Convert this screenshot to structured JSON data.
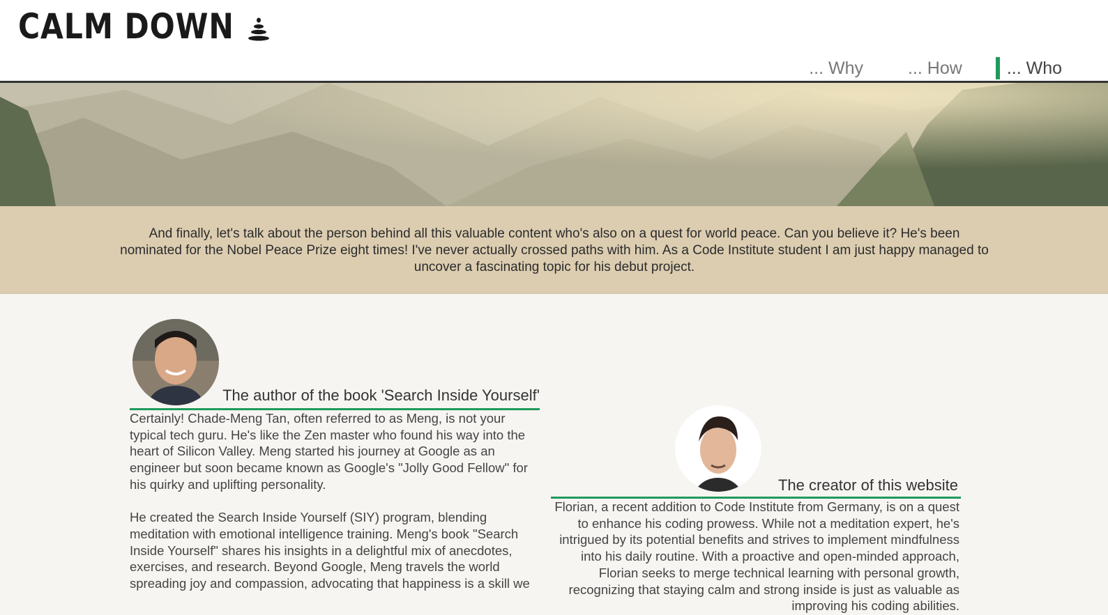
{
  "brand": {
    "logo_text": "CALM DOWN",
    "logo_icon": "stacked-stones-icon"
  },
  "nav": {
    "items": [
      {
        "label": "... Why",
        "active": false
      },
      {
        "label": "... How",
        "active": false
      },
      {
        "label": "... Who",
        "active": true
      }
    ],
    "accent_color": "#1f9a5a"
  },
  "hero": {
    "image": "misty-mountain-valley"
  },
  "intro": {
    "text": "And finally, let's talk about the person behind all this valuable content who's also on a quest for world peace. Can you believe it? He's been nominated for the Nobel Peace Prize eight times! I've never actually crossed paths with him. As a Code Institute student I am just happy managed to uncover a fascinating topic for his debut project."
  },
  "cards": [
    {
      "title": "The author of the book 'Search Inside Yourself'",
      "avatar": "portrait-chade-meng-tan",
      "paragraphs": [
        "Certainly! Chade-Meng Tan, often referred to as Meng, is not your typical tech guru. He's like the Zen master who found his way into the heart of Silicon Valley. Meng started his journey at Google as an engineer but soon became known as Google's \"Jolly Good Fellow\" for his quirky and uplifting personality.",
        "He created the Search Inside Yourself (SIY) program, blending meditation with emotional intelligence training. Meng's book \"Search Inside Yourself\" shares his insights in a delightful mix of anecdotes, exercises, and research. Beyond Google, Meng travels the world spreading joy and compassion, advocating that happiness is a skill we"
      ]
    },
    {
      "title": "The creator of this website",
      "avatar": "portrait-florian",
      "paragraphs": [
        "Florian, a recent addition to Code Institute from Germany, is on a quest to enhance his coding prowess. While not a meditation expert, he's intrigued by its potential benefits and strives to implement mindfulness into his daily routine. With a proactive and open-minded approach, Florian seeks to merge technical learning with personal growth, recognizing that staying calm and strong inside is just as valuable as improving his coding abilities."
      ]
    }
  ]
}
